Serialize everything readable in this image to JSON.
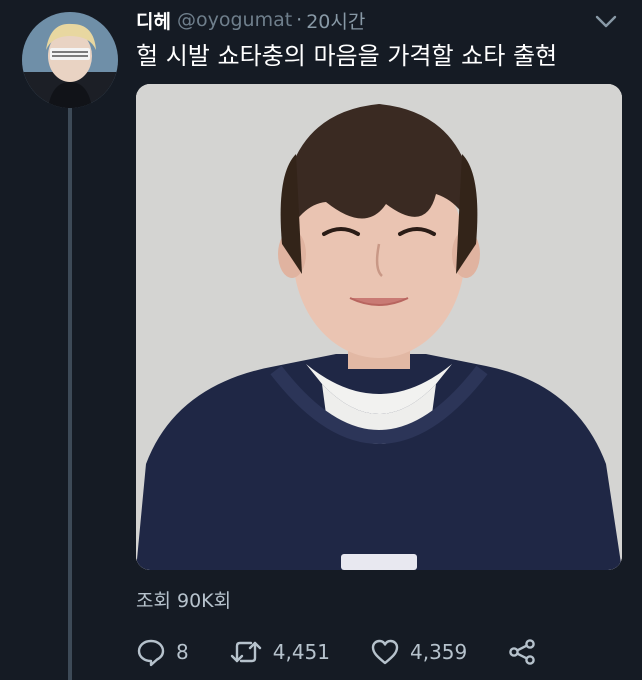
{
  "tweet": {
    "display_name": "디헤",
    "handle": "@oyogumat",
    "separator": "·",
    "time": "20시간",
    "text": "헐 시발 쇼타충의 마음을 가격할 쇼타 출현",
    "views": "조회 90K회",
    "replies": "8",
    "retweets": "4,451",
    "likes": "4,359"
  },
  "colors": {
    "background": "#151b24",
    "icon": "#b6c2cc",
    "thread_line": "#3d4a57"
  },
  "icons": [
    "chevron-down-icon",
    "reply-icon",
    "retweet-icon",
    "like-icon",
    "share-icon"
  ]
}
